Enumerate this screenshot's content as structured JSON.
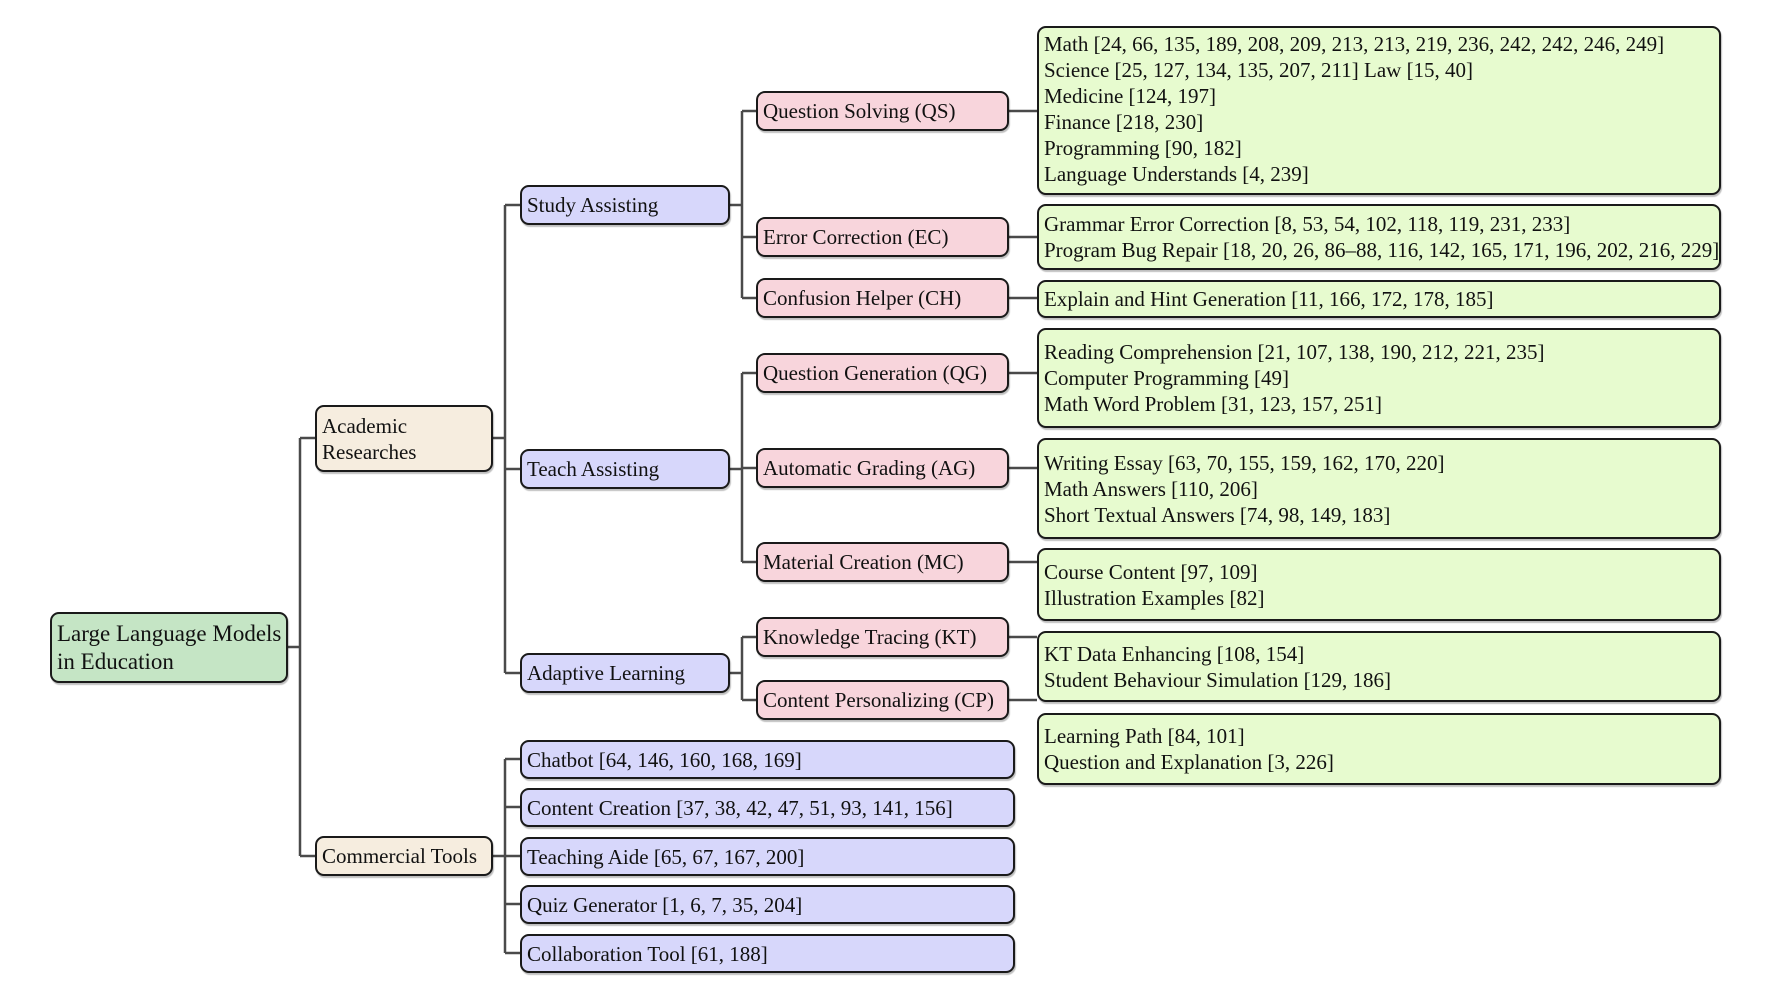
{
  "root": {
    "label_lines": [
      "Large Language Models",
      "in Education"
    ]
  },
  "academic": {
    "label_lines": [
      "Academic",
      "Researches"
    ],
    "groups": [
      {
        "label": "Study Assisting",
        "tasks": [
          {
            "label": "Question Solving (QS)",
            "items": [
              "Math [24, 66, 135, 189, 208, 209, 213, 213, 219, 236, 242, 242, 246, 249]",
              "Science [25, 127, 134, 135, 207, 211] Law [15, 40]",
              "Medicine [124, 197]",
              "Finance [218, 230]",
              "Programming [90, 182]",
              "Language Understands [4, 239]"
            ]
          },
          {
            "label": "Error Correction (EC)",
            "items": [
              "Grammar Error Correction [8, 53, 54, 102, 118, 119, 231, 233]",
              "Program Bug Repair [18, 20, 26, 86–88, 116, 142, 165, 171, 196, 202, 216, 229]"
            ]
          },
          {
            "label": "Confusion Helper (CH)",
            "items": [
              "Explain and Hint Generation [11, 166, 172, 178, 185]"
            ]
          }
        ]
      },
      {
        "label": "Teach Assisting",
        "tasks": [
          {
            "label": "Question Generation (QG)",
            "items": [
              "Reading Comprehension [21, 107, 138, 190, 212, 221, 235]",
              "Computer Programming [49]",
              "Math Word Problem [31, 123, 157, 251]"
            ]
          },
          {
            "label": "Automatic Grading (AG)",
            "items": [
              "Writing Essay [63, 70, 155, 159, 162, 170, 220]",
              "Math Answers [110, 206]",
              "Short Textual Answers [74, 98, 149, 183]"
            ]
          },
          {
            "label": "Material Creation (MC)",
            "items": [
              "Course Content [97, 109]",
              "Illustration Examples [82]"
            ]
          }
        ]
      },
      {
        "label": "Adaptive Learning",
        "tasks": [
          {
            "label": "Knowledge Tracing (KT)",
            "items": [
              "KT Data Enhancing [108, 154]",
              "Student Behaviour Simulation [129, 186]"
            ]
          },
          {
            "label": "Content Personalizing (CP)",
            "items": [
              "Learning Path [84, 101]",
              "Question and Explanation [3, 226]"
            ]
          }
        ]
      }
    ]
  },
  "commercial": {
    "label": "Commercial Tools",
    "items": [
      "Chatbot [64, 146, 160, 168, 169]",
      "Content Creation [37, 38, 42, 47, 51, 93, 141, 156]",
      "Teaching Aide [65, 67, 167, 200]",
      "Quiz Generator [1, 6, 7, 35, 204]",
      "Collaboration Tool [61, 188]"
    ]
  },
  "colors": {
    "root": "#c5e5c5",
    "category": "#f6eddf",
    "group": "#d7d7fb",
    "task": "#f8d5dc",
    "leaf": "#e7fbcf",
    "connector": "#4a4a4a"
  }
}
